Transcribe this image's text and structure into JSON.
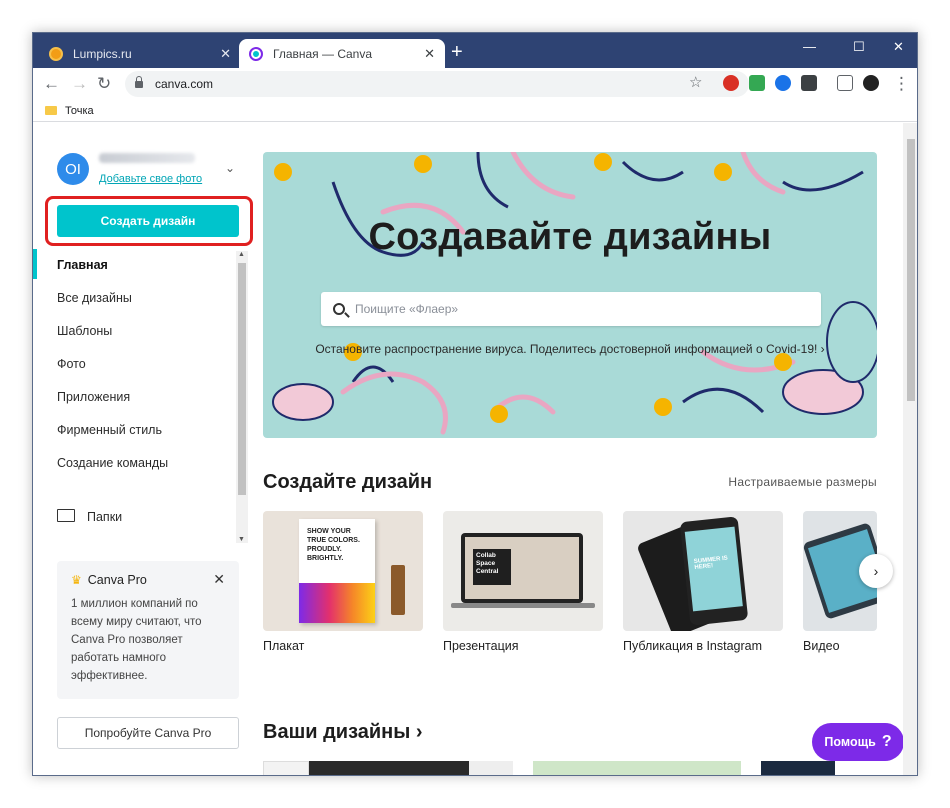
{
  "browser": {
    "tabs": [
      {
        "label": "Lumpics.ru",
        "active": false
      },
      {
        "label": "Главная — Canva",
        "active": true
      }
    ],
    "url": "canva.com",
    "bookmark": "Точка",
    "window_controls": {
      "minimize": "—",
      "maximize": "☐",
      "close": "✕"
    }
  },
  "sidebar": {
    "avatar_initials": "OI",
    "add_photo": "Добавьте свое фото",
    "create_button": "Создать дизайн",
    "nav": [
      "Главная",
      "Все дизайны",
      "Шаблоны",
      "Фото",
      "Приложения",
      "Фирменный стиль",
      "Создание команды"
    ],
    "folders": "Папки",
    "pro_card": {
      "title": "Canva Pro",
      "text": "1 миллион компаний по всему миру считают, что Canva Pro позволяет работать намного эффективнее."
    },
    "try_button": "Попробуйте Canva Pro"
  },
  "hero": {
    "title": "Создавайте дизайны",
    "search_placeholder": "Поищите «Флаер»",
    "note": "Остановите распространение вируса. Поделитесь достоверной информацией о Covid-19! ›"
  },
  "create_section": {
    "title": "Создайте дизайн",
    "custom_sizes": "Настраиваемые размеры",
    "cards": [
      "Плакат",
      "Презентация",
      "Публикация в Instagram",
      "Видео"
    ],
    "poster_text": "SHOW YOUR TRUE COLORS. PROUDLY. BRIGHTLY.",
    "presentation_text": "Collab Space Central",
    "instagram_text": "SUMMER IS HERE!"
  },
  "designs_section": {
    "title": "Ваши дизайны ›"
  },
  "help_button": {
    "label": "Помощь",
    "icon": "?"
  },
  "colors": {
    "accent": "#00c4cc",
    "purple": "#7d2ae8",
    "hero_bg": "#a9dad7",
    "highlight": "#e02020"
  }
}
